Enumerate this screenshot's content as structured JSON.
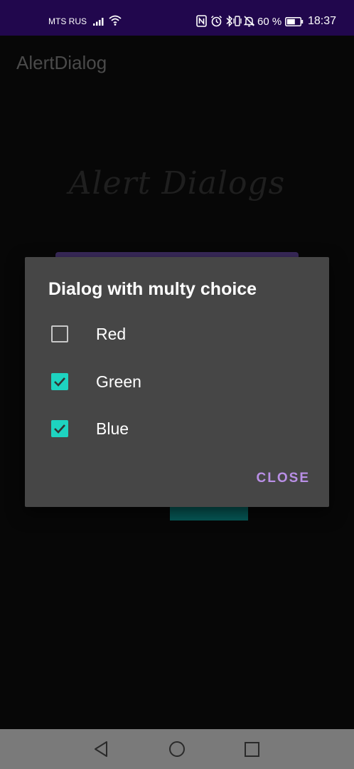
{
  "status_bar": {
    "carrier": "MTS RUS",
    "battery_percent": "60 %",
    "time": "18:37",
    "icons": [
      "signal-icon",
      "wifi-icon",
      "nfc-icon",
      "alarm-icon",
      "bluetooth-icon",
      "vibrate-icon",
      "mute-icon",
      "battery-icon"
    ]
  },
  "app_bar": {
    "title": "AlertDialog"
  },
  "main": {
    "hero_title": "Alert Dialogs"
  },
  "dialog": {
    "title": "Dialog with multy choice",
    "options": [
      {
        "label": "Red",
        "checked": false
      },
      {
        "label": "Green",
        "checked": true
      },
      {
        "label": "Blue",
        "checked": true
      }
    ],
    "close_label": "CLOSE"
  },
  "nav_bar": {
    "icons": [
      "back-icon",
      "home-icon",
      "recents-icon"
    ]
  },
  "colors": {
    "status_bar": "#21074d",
    "background": "#070707",
    "dialog": "#464646",
    "checkbox_checked": "#1ed3c0",
    "accent": "#b98fe6",
    "nav_bar": "#7a7a7a"
  }
}
